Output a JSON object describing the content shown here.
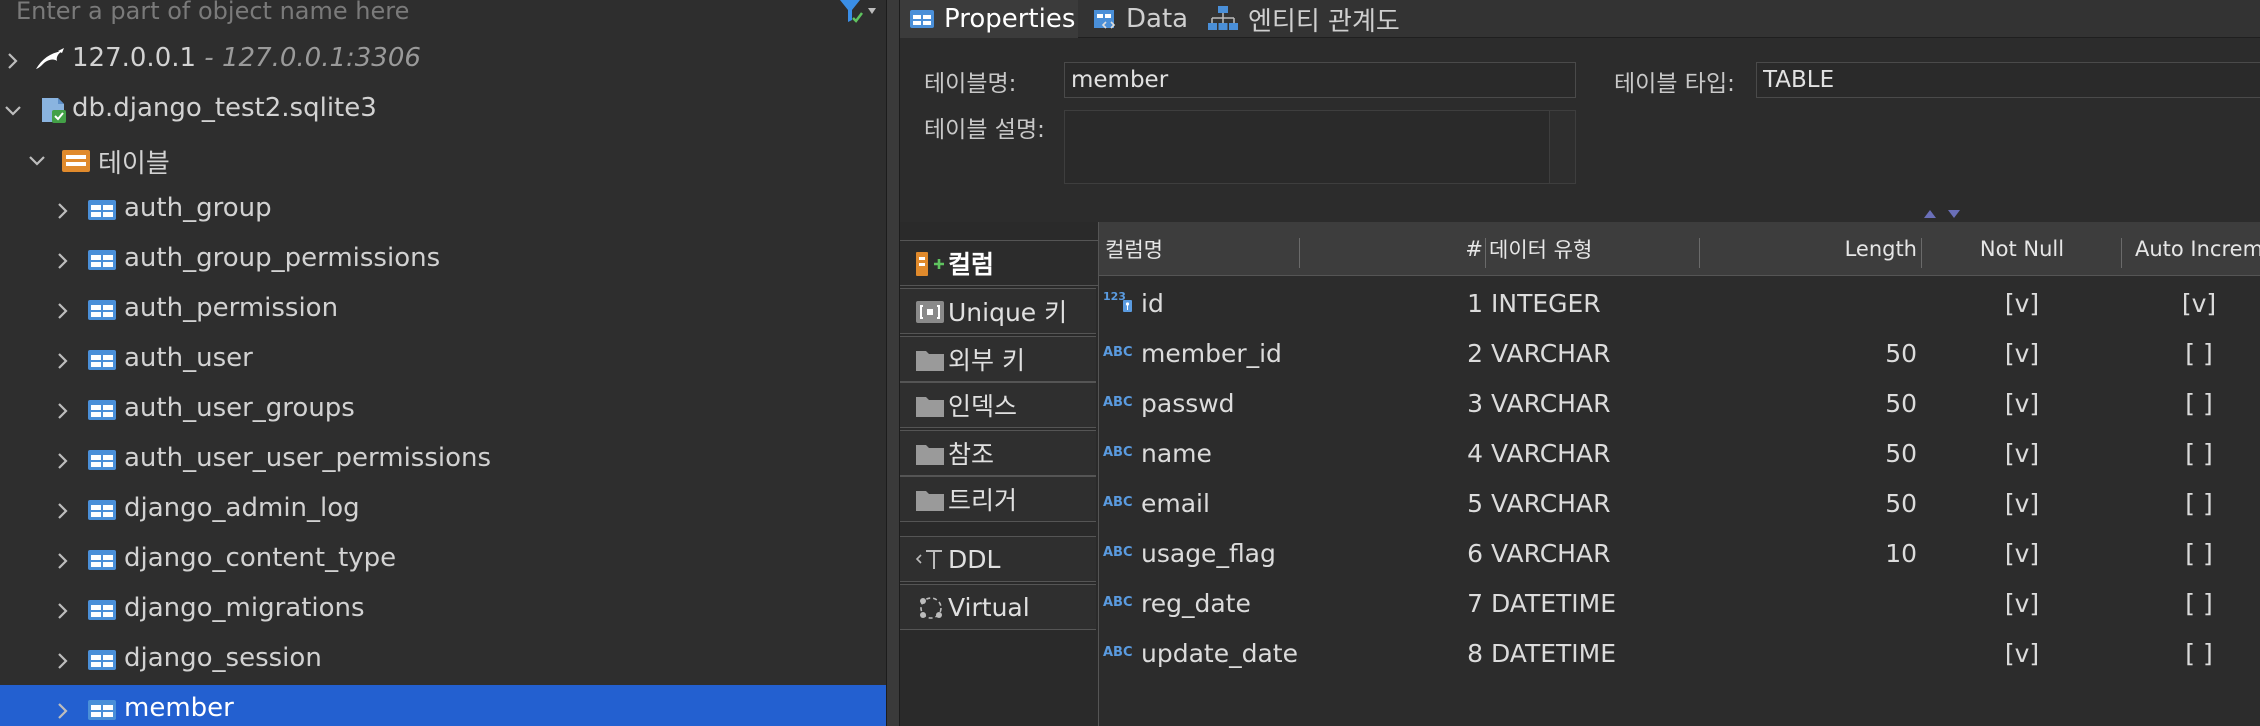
{
  "navigator": {
    "search_placeholder": "Enter a part of object name here",
    "connections": [
      {
        "label": "127.0.0.1",
        "sub": " - 127.0.0.1:3306",
        "icon": "mysql-dolphin-icon",
        "expanded": false
      },
      {
        "label": "db.django_test2.sqlite3",
        "icon": "sqlite-database-icon",
        "expanded": true
      }
    ],
    "tables_folder": {
      "label": "테이블",
      "icon": "tables-folder-icon"
    },
    "tables": [
      "auth_group",
      "auth_group_permissions",
      "auth_permission",
      "auth_user",
      "auth_user_groups",
      "auth_user_user_permissions",
      "django_admin_log",
      "django_content_type",
      "django_migrations",
      "django_session",
      "member"
    ],
    "selected_table": "member"
  },
  "editor": {
    "tabs": [
      {
        "label": "Properties",
        "icon": "properties-icon",
        "active": true
      },
      {
        "label": "Data",
        "icon": "data-grid-icon",
        "active": false
      },
      {
        "label": "엔티티 관계도",
        "icon": "er-diagram-icon",
        "active": false
      }
    ],
    "form": {
      "table_name_label": "테이블명:",
      "table_name_value": "member",
      "table_type_label": "테이블 타입:",
      "table_type_value": "TABLE",
      "table_desc_label": "테이블 설명:"
    },
    "side_tabs": [
      {
        "label": "컬럼",
        "icon": "columns-add-icon",
        "active": true
      },
      {
        "label": "Unique 키",
        "icon": "unique-key-icon",
        "active": false
      },
      {
        "label": "외부 키",
        "icon": "folder-icon",
        "active": false
      },
      {
        "label": "인덱스",
        "icon": "folder-icon",
        "active": false
      },
      {
        "label": "참조",
        "icon": "folder-icon",
        "active": false
      },
      {
        "label": "트리거",
        "icon": "folder-icon",
        "active": false
      },
      {
        "label": "DDL",
        "icon": "ddl-text-icon",
        "active": false
      },
      {
        "label": "Virtual",
        "icon": "virtual-icon",
        "active": false
      }
    ],
    "columns_grid": {
      "headers": {
        "name": "컬럼명",
        "num": "#",
        "type": "데이터 유형",
        "length": "Length",
        "not_null": "Not Null",
        "auto_inc": "Auto Incremer"
      },
      "rows": [
        {
          "icon": "numeric-key-icon",
          "name": "id",
          "num": "1",
          "type": "INTEGER",
          "length": "",
          "not_null": "[v]",
          "auto_inc": "[v]"
        },
        {
          "icon": "abc-text-icon",
          "name": "member_id",
          "num": "2",
          "type": "VARCHAR",
          "length": "50",
          "not_null": "[v]",
          "auto_inc": "[ ]"
        },
        {
          "icon": "abc-text-icon",
          "name": "passwd",
          "num": "3",
          "type": "VARCHAR",
          "length": "50",
          "not_null": "[v]",
          "auto_inc": "[ ]"
        },
        {
          "icon": "abc-text-icon",
          "name": "name",
          "num": "4",
          "type": "VARCHAR",
          "length": "50",
          "not_null": "[v]",
          "auto_inc": "[ ]"
        },
        {
          "icon": "abc-text-icon",
          "name": "email",
          "num": "5",
          "type": "VARCHAR",
          "length": "50",
          "not_null": "[v]",
          "auto_inc": "[ ]"
        },
        {
          "icon": "abc-text-icon",
          "name": "usage_flag",
          "num": "6",
          "type": "VARCHAR",
          "length": "10",
          "not_null": "[v]",
          "auto_inc": "[ ]"
        },
        {
          "icon": "abc-text-icon",
          "name": "reg_date",
          "num": "7",
          "type": "DATETIME",
          "length": "",
          "not_null": "[v]",
          "auto_inc": "[ ]"
        },
        {
          "icon": "abc-text-icon",
          "name": "update_date",
          "num": "8",
          "type": "DATETIME",
          "length": "",
          "not_null": "[v]",
          "auto_inc": "[ ]"
        }
      ]
    }
  },
  "colors": {
    "selection": "#2360d0",
    "table_icon": "#4a8fd8",
    "folder_icon": "#e08a2c",
    "abc_icon": "#5a9be0"
  }
}
